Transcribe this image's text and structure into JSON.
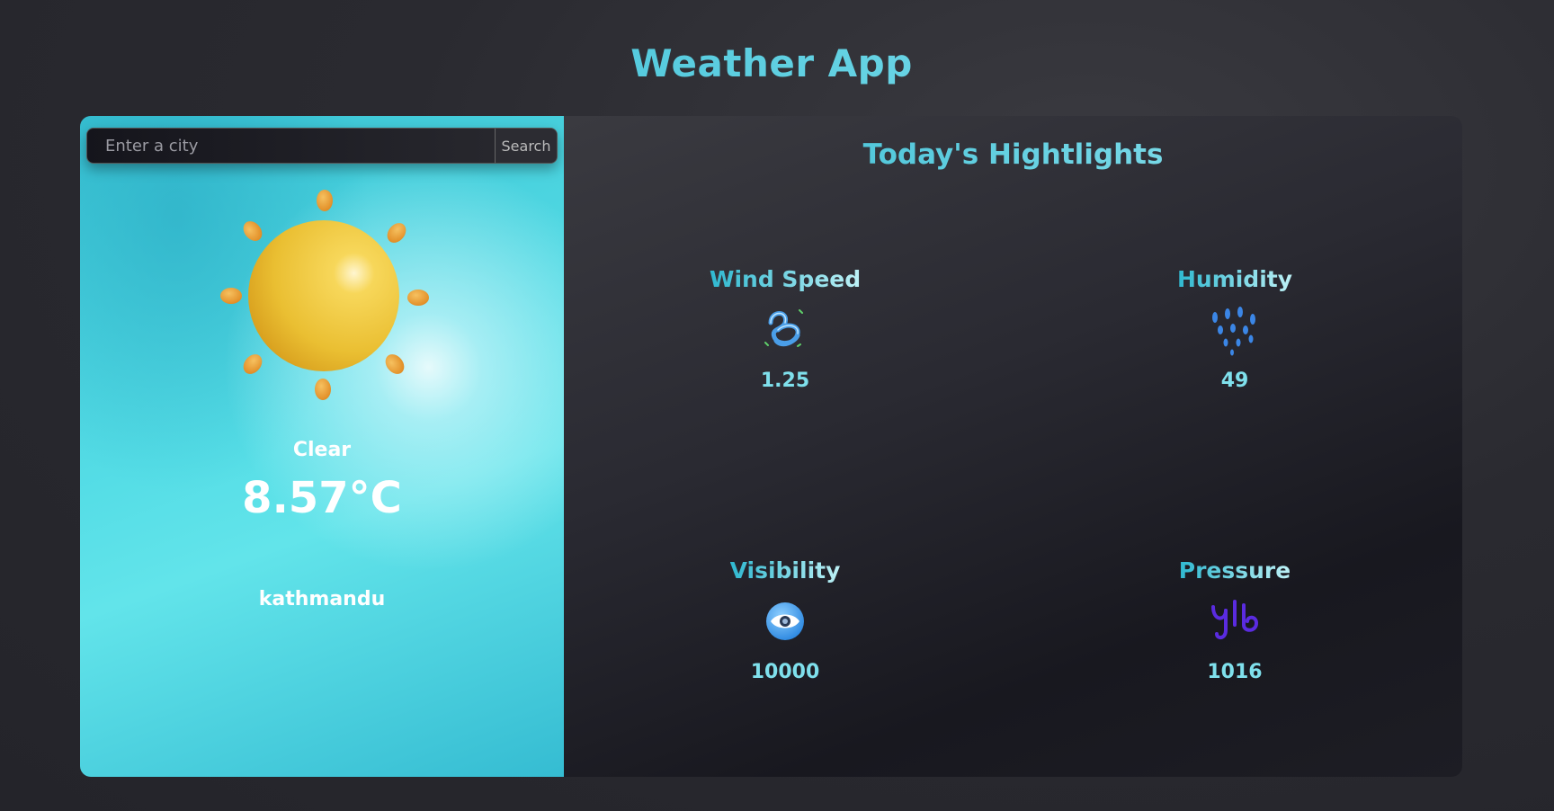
{
  "app": {
    "title": "Weather App"
  },
  "search": {
    "placeholder": "Enter a city",
    "value": "",
    "button_label": "Search"
  },
  "current": {
    "icon": "sun-icon",
    "condition": "Clear",
    "temperature": "8.57°C",
    "city": "kathmandu"
  },
  "highlights": {
    "title": "Today's Hightlights",
    "wind_speed": {
      "label": "Wind Speed",
      "value": "1.25",
      "icon": "wind-icon"
    },
    "humidity": {
      "label": "Humidity",
      "value": "49",
      "icon": "raindrops-icon"
    },
    "visibility": {
      "label": "Visibility",
      "value": "10000",
      "icon": "eye-icon"
    },
    "pressure": {
      "label": "Pressure",
      "value": "1016",
      "icon": "pressure-icon"
    }
  },
  "colors": {
    "accent_cyan": "#2fb8d0",
    "left_panel": "#55dde6",
    "sun": "#f2c53d",
    "sun_rays": "#e89a2f",
    "pressure_icon": "#6a2ee8",
    "eye_icon": "#3aa0e8"
  }
}
